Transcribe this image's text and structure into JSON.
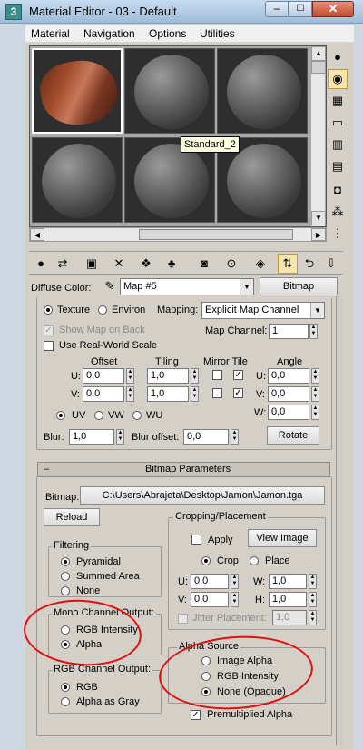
{
  "window": {
    "title": "Material Editor - 03 - Default",
    "app_icon": "3",
    "minimize_glyph": "–",
    "maximize_glyph": "☐",
    "close_glyph": "✕"
  },
  "menu": {
    "items": [
      "Material",
      "Navigation",
      "Options",
      "Utilities"
    ]
  },
  "slots": {
    "tooltip": "Standard_2"
  },
  "right_toolbar": {
    "icons": [
      "sample-type-sphere-icon",
      "backlight-icon",
      "background-checker-icon",
      "sample-uv-tiling-icon",
      "video-color-check-icon",
      "make-preview-icon",
      "options-icon",
      "select-by-material-icon",
      "material-map-navigator-icon"
    ]
  },
  "bottom_toolbar": {
    "icons": [
      "get-material-icon",
      "put-to-scene-icon",
      "assign-to-selection-icon",
      "reset-map-icon",
      "make-unique-icon",
      "put-to-library-icon",
      "material-effects-channel-icon",
      "show-map-in-viewport-icon",
      "show-end-result-icon",
      "go-to-parent-icon",
      "go-forward-to-sibling-icon"
    ]
  },
  "map_row": {
    "label": "Diffuse Color:",
    "map_name": "Map #5",
    "type_button": "Bitmap"
  },
  "coordinates": {
    "texture_label": "Texture",
    "environ_label": "Environ",
    "mapping_label": "Mapping:",
    "mapping_value": "Explicit Map Channel",
    "show_map_on_back": "Show Map on Back",
    "map_channel_label": "Map Channel:",
    "map_channel_value": "1",
    "real_world_scale": "Use Real-World Scale",
    "offset_header": "Offset",
    "tiling_header": "Tiling",
    "mirror_tile_header": "Mirror Tile",
    "angle_header": "Angle",
    "u_label": "U:",
    "v_label": "V:",
    "w_label": "W:",
    "u_offset": "0,0",
    "v_offset": "0,0",
    "u_tiling": "1,0",
    "v_tiling": "1,0",
    "u_angle": "0,0",
    "v_angle": "0,0",
    "w_angle": "0,0",
    "tile_check": "✓",
    "uv_label": "UV",
    "vw_label": "VW",
    "wu_label": "WU",
    "blur_label": "Blur:",
    "blur_value": "1,0",
    "blur_offset_label": "Blur offset:",
    "blur_offset_value": "0,0",
    "rotate_button": "Rotate"
  },
  "bitmap_params": {
    "rollout_sign": "–",
    "rollout_title": "Bitmap Parameters",
    "bitmap_label": "Bitmap:",
    "bitmap_path": "C:\\Users\\Abrajeta\\Desktop\\Jamon\\Jamon.tga",
    "reload_button": "Reload",
    "cropping_title": "Cropping/Placement",
    "apply_label": "Apply",
    "view_image_button": "View Image",
    "crop_label": "Crop",
    "place_label": "Place",
    "u_label": "U:",
    "v_label": "V:",
    "w_label": "W:",
    "h_label": "H:",
    "crop_u": "0,0",
    "crop_v": "0,0",
    "crop_w": "1,0",
    "crop_h": "1,0",
    "jitter_label": "Jitter Placement:",
    "jitter_value": "1,0",
    "filtering_title": "Filtering",
    "pyramidal": "Pyramidal",
    "summed_area": "Summed Area",
    "none": "None",
    "mono_title": "Mono Channel Output:",
    "rgb_intensity": "RGB Intensity",
    "alpha": "Alpha",
    "rgb_channel_title": "RGB Channel Output:",
    "rgb": "RGB",
    "alpha_as_gray": "Alpha as Gray",
    "alpha_source_title": "Alpha Source",
    "image_alpha": "Image Alpha",
    "alpha_rgb_intensity": "RGB Intensity",
    "none_opaque": "None (Opaque)",
    "premultiplied_alpha": "Premultiplied Alpha",
    "premult_check": "✓"
  },
  "colors": {
    "annotation": "#e01010",
    "panel_bg": "#d4d0c8"
  }
}
